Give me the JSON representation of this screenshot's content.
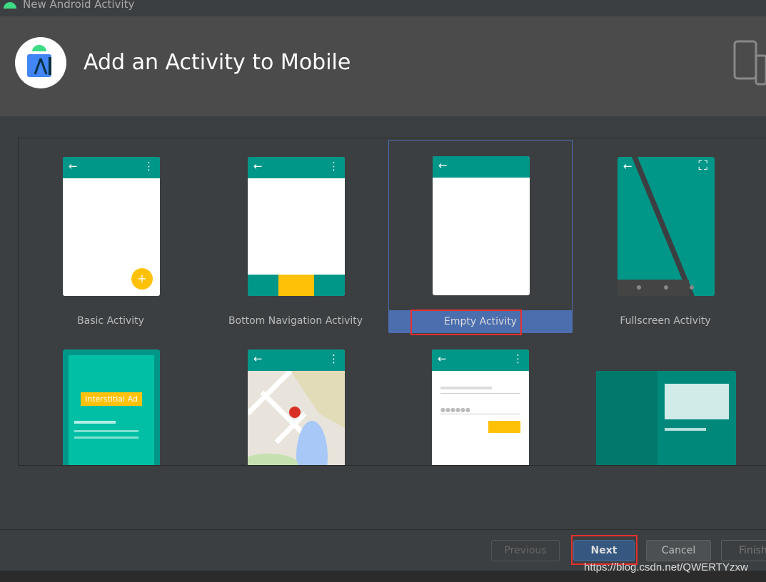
{
  "window": {
    "title": "New Android Activity"
  },
  "header": {
    "title": "Add an Activity to Mobile"
  },
  "templates": [
    {
      "label": "Basic Activity"
    },
    {
      "label": "Bottom Navigation Activity"
    },
    {
      "label": "Empty Activity",
      "selected": true
    },
    {
      "label": "Fullscreen Activity"
    },
    {
      "label": ""
    },
    {
      "label": ""
    },
    {
      "label": ""
    },
    {
      "label": ""
    }
  ],
  "ad_badge": "Interstitial Ad",
  "buttons": {
    "previous": "Previous",
    "next": "Next",
    "cancel": "Cancel",
    "finish": "Finish"
  },
  "watermark": "https://blog.csdn.net/QWERTYzxw",
  "colors": {
    "accent": "#009688",
    "selection": "#4b6eaf",
    "highlight": "#e8302f"
  }
}
